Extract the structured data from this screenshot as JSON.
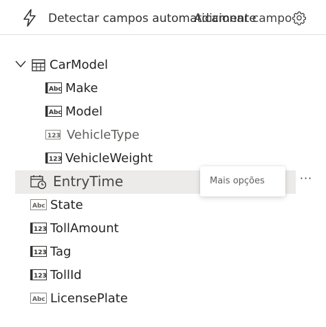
{
  "toolbar": {
    "detect_label": "Detectar campos automaticamente",
    "add_field_label": "Adicionar campo",
    "settings_icon": "gear-icon",
    "detect_icon": "lightning-bolt-icon"
  },
  "tree": {
    "root": {
      "label": "CarModel",
      "icon": "table-icon",
      "expanded": true,
      "children": [
        {
          "label": "Make",
          "type": "text"
        },
        {
          "label": "Model",
          "type": "text"
        },
        {
          "label": "VehicleType",
          "type": "number"
        },
        {
          "label": "VehicleWeight",
          "type": "number"
        }
      ]
    },
    "fields": [
      {
        "label": "EntryTime",
        "type": "datetime",
        "hovered": true
      },
      {
        "label": "State",
        "type": "text"
      },
      {
        "label": "TollAmount",
        "type": "number"
      },
      {
        "label": "Tag",
        "type": "number"
      },
      {
        "label": "TollId",
        "type": "number"
      },
      {
        "label": "LicensePlate",
        "type": "text"
      }
    ]
  },
  "tooltip": {
    "text": "Mais opções"
  },
  "more_button": {
    "label": "···"
  },
  "colors": {
    "hover_row": "#edebe9",
    "text": "#252423",
    "icon": "#323130"
  }
}
